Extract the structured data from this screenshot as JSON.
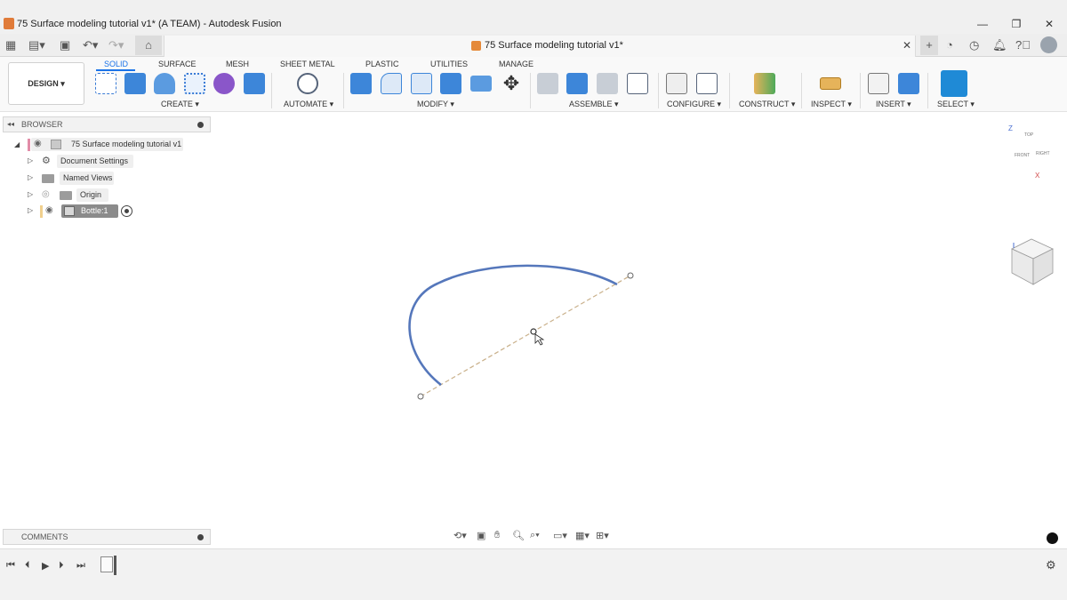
{
  "window": {
    "title": "75 Surface modeling tutorial v1* (A TEAM) - Autodesk Fusion",
    "minimize": "—",
    "maximize": "❐",
    "close": "✕"
  },
  "doc_tab": {
    "title": "75 Surface modeling tutorial v1*",
    "close": "✕"
  },
  "workspace": {
    "label": "DESIGN ▾"
  },
  "tabs": [
    "SOLID",
    "SURFACE",
    "MESH",
    "SHEET METAL",
    "PLASTIC",
    "UTILITIES",
    "MANAGE"
  ],
  "groups": {
    "create": "CREATE ▾",
    "automate": "AUTOMATE ▾",
    "modify": "MODIFY ▾",
    "assemble": "ASSEMBLE ▾",
    "configure": "CONFIGURE ▾",
    "construct": "CONSTRUCT ▾",
    "inspect": "INSPECT ▾",
    "insert": "INSERT ▾",
    "select": "SELECT ▾"
  },
  "browser": {
    "title": "BROWSER",
    "root": "75 Surface modeling tutorial v1",
    "items": [
      {
        "label": "Document Settings"
      },
      {
        "label": "Named Views"
      },
      {
        "label": "Origin"
      },
      {
        "label": "Bottle:1"
      }
    ]
  },
  "comments": {
    "title": "COMMENTS"
  },
  "viewcube": {
    "top": "TOP",
    "front": "FRONT",
    "right": "RIGHT",
    "z": "Z",
    "x": "X"
  },
  "colors": {
    "accent": "#1a73e8",
    "curve": "#5577bb",
    "construction_line": "#c9b08a"
  }
}
